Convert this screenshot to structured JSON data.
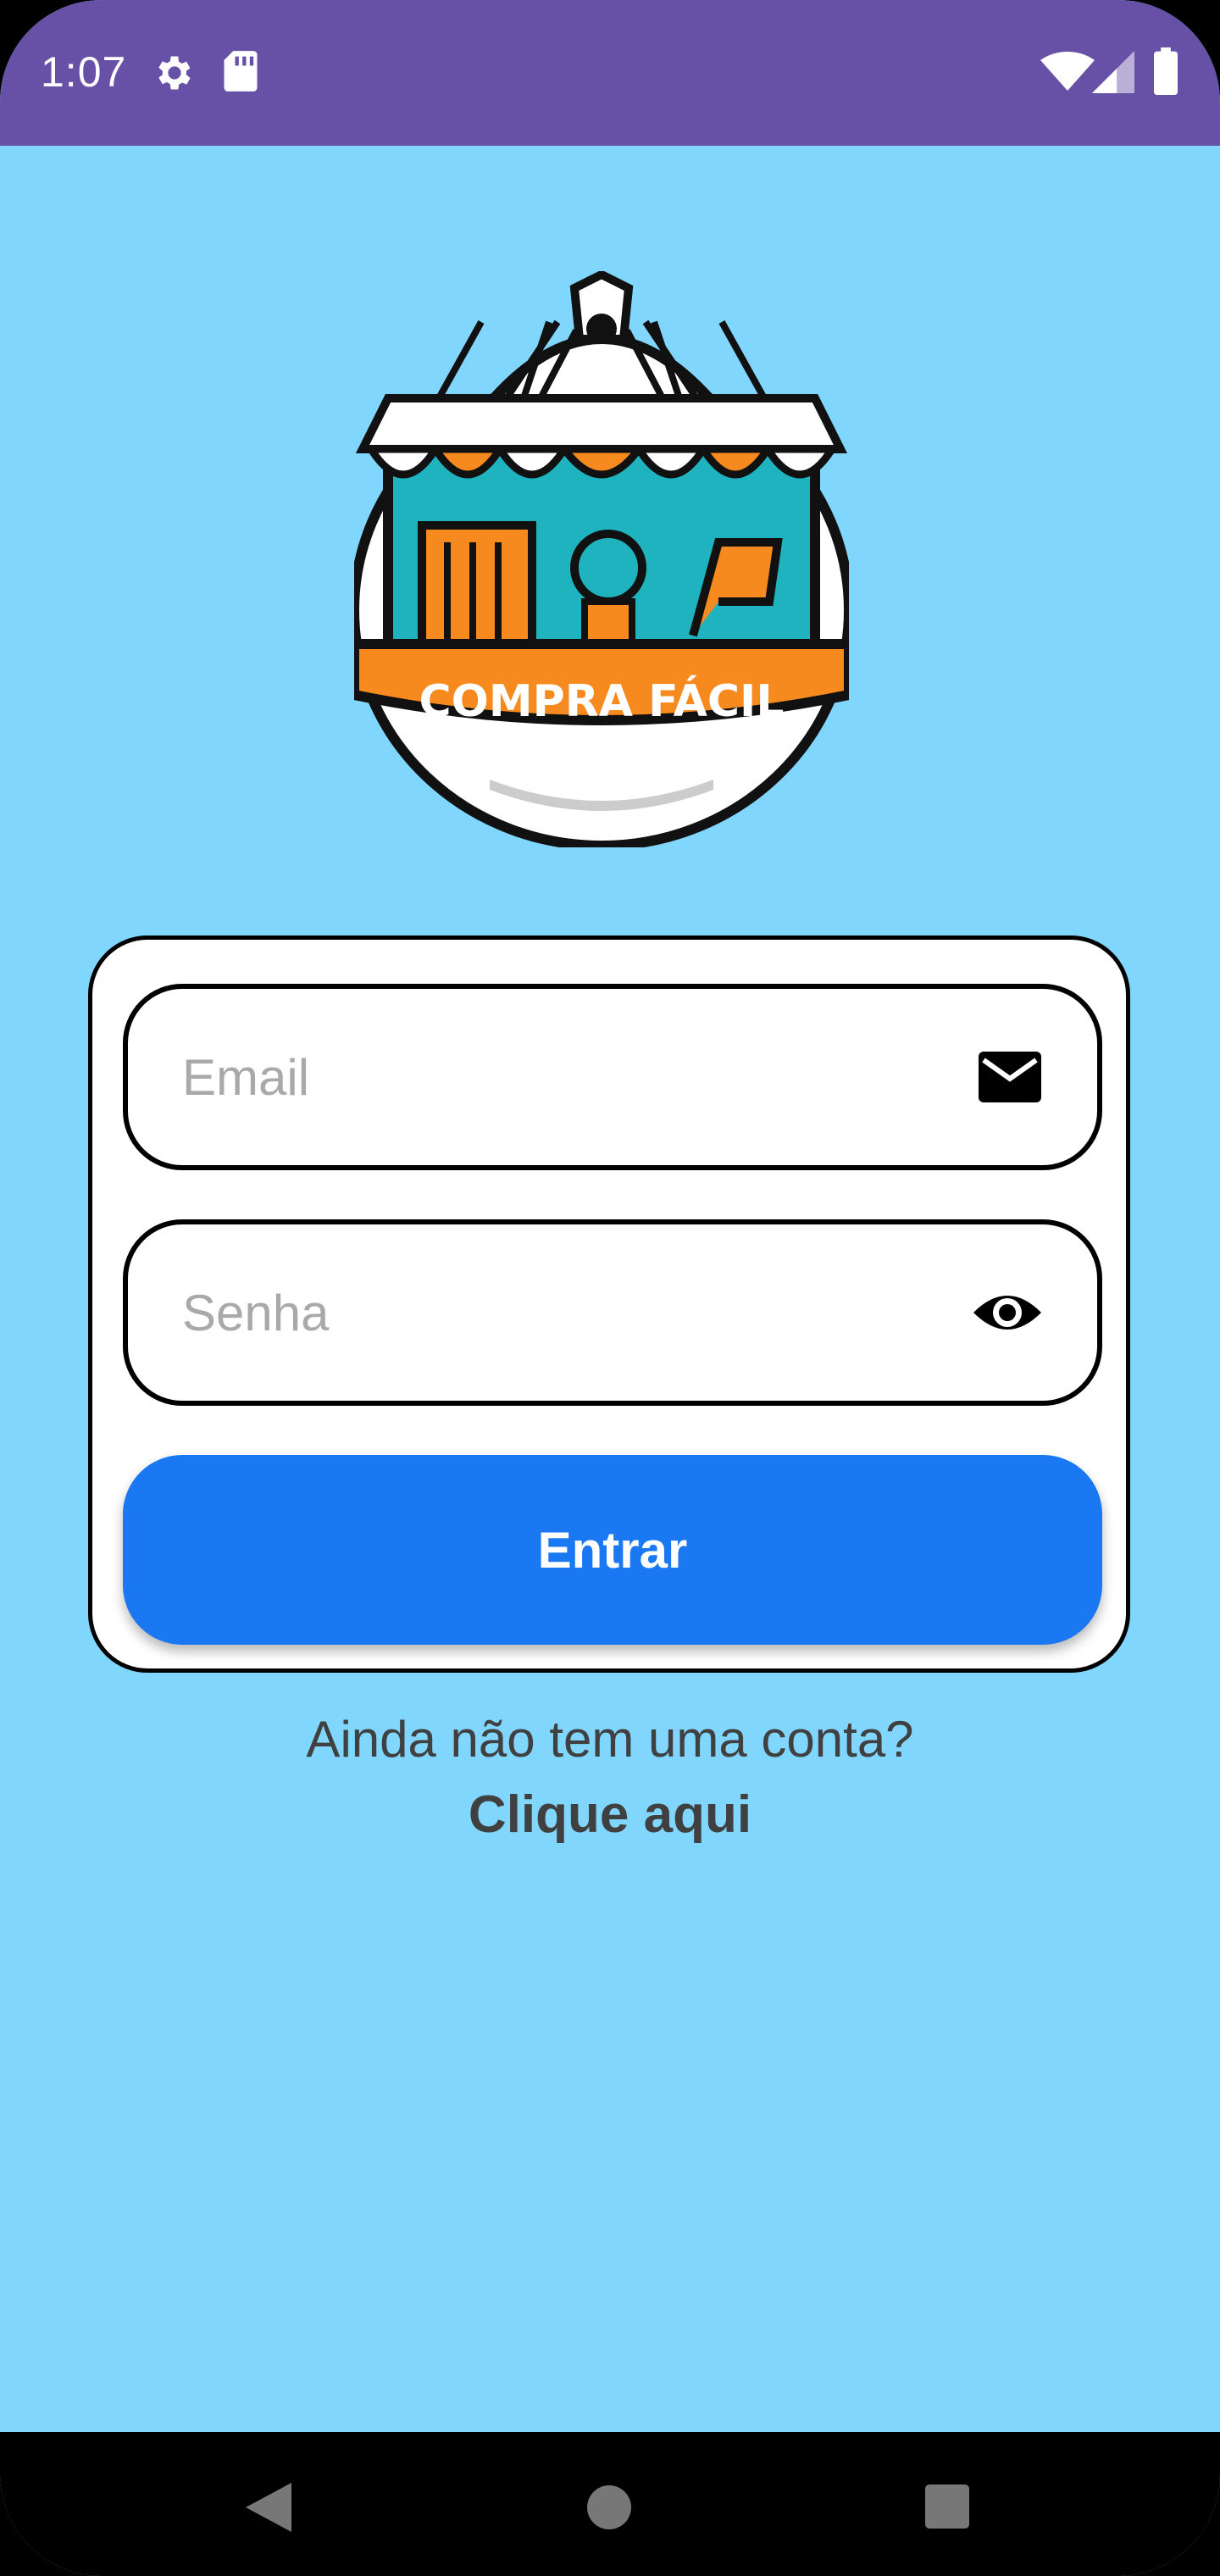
{
  "status_bar": {
    "time": "1:07",
    "icons": [
      "gear-icon",
      "sd-card-icon",
      "wifi-icon",
      "cell-signal-icon",
      "battery-icon"
    ],
    "color": "#6751a6"
  },
  "logo": {
    "text": "COMPRA FÁCIL"
  },
  "login_form": {
    "email_placeholder": "Email",
    "email_icon": "mail-icon",
    "password_placeholder": "Senha",
    "password_icon": "eye-icon",
    "submit_label": "Entrar"
  },
  "signup": {
    "question": "Ainda não tem uma conta?",
    "link": "Clique aqui"
  },
  "nav_bar": {
    "icons": [
      "back-icon",
      "home-icon",
      "recents-icon"
    ]
  },
  "colors": {
    "background": "#80d6fd",
    "button": "#1a79f2",
    "status_bar": "#6751a6"
  }
}
